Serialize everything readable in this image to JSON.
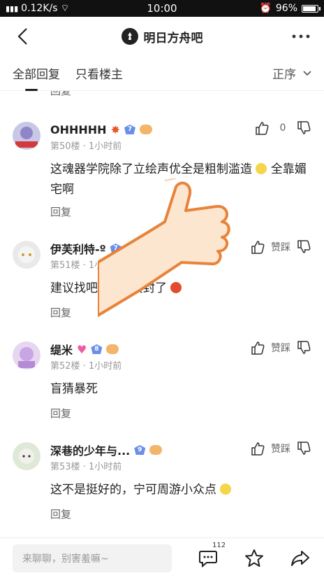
{
  "status_bar": {
    "signal_text": "⁴ᴳ",
    "speed": "0.12K/s",
    "time": "10:00",
    "battery": "96%",
    "battery_level": 0.96
  },
  "header": {
    "title": "明日方舟吧",
    "back_icon": "back-arrow-icon",
    "more_icon": "more-dots-icon"
  },
  "tabs": {
    "all_replies": "全部回复",
    "op_only": "只看楼主",
    "sort_label": "正序"
  },
  "reply_label": "回复",
  "posts": [
    {
      "username": "OHHHHH",
      "level": "7",
      "floor_time": "第50楼 · 1小时前",
      "content": "这魂器学院除了立绘声优全是粗制滥造",
      "content_tail": " 全靠媚宅啊",
      "like_count": "0",
      "avatar_color": "#c9c7e6"
    },
    {
      "username": "伊芙利特-º",
      "level": "7",
      "floor_time": "第51楼 · 1小时前",
      "content": "建议找吧",
      "content_tail": "楼封了",
      "like_label": "赞踩",
      "avatar_color": "#e9e9e9"
    },
    {
      "username": "缇米",
      "level": "8",
      "floor_time": "第52楼 · 1小时前",
      "content": "盲猜暴死",
      "like_label": "赞踩",
      "avatar_color": "#e6d6f0"
    },
    {
      "username": "深巷的少年与...",
      "level": "9",
      "floor_time": "第53楼 · 1小时前",
      "content": "这不是挺好的，宁可周游小众点",
      "like_label": "赞踩",
      "avatar_color": "#dfe9d8"
    }
  ],
  "bottom_bar": {
    "input_placeholder": "来聊聊，别害羞嘛~",
    "comment_count": "112",
    "comment_icon": "comment-icon",
    "star_icon": "star-icon",
    "share_icon": "share-icon"
  },
  "colors": {
    "accent": "#222222",
    "level_badge": "#6a8fe8",
    "thumb_skin": "#fde6cf",
    "thumb_outline": "#e8833a"
  }
}
